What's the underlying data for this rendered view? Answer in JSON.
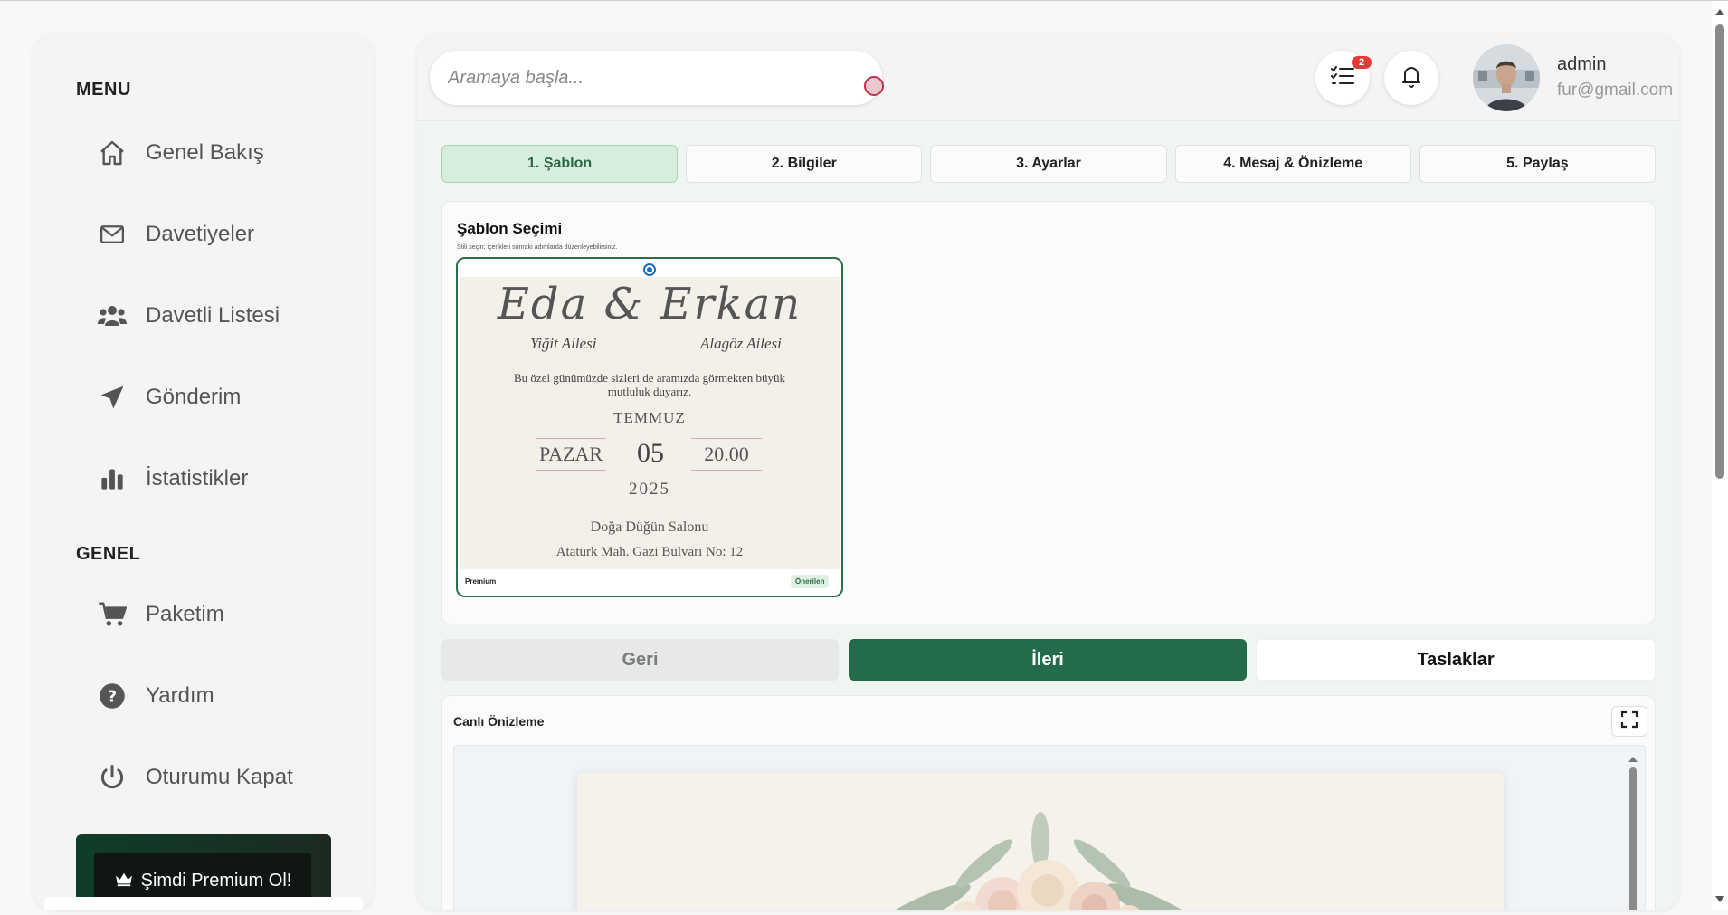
{
  "sidebar": {
    "menu_title": "MENU",
    "general_title": "GENEL",
    "items": [
      {
        "label": "Genel Bakış",
        "icon": "home-icon"
      },
      {
        "label": "Davetiyeler",
        "icon": "mail-icon"
      },
      {
        "label": "Davetli Listesi",
        "icon": "users-icon"
      },
      {
        "label": "Gönderim",
        "icon": "send-icon"
      },
      {
        "label": "İstatistikler",
        "icon": "bar-chart-icon"
      }
    ],
    "general_items": [
      {
        "label": "Paketim",
        "icon": "cart-icon"
      },
      {
        "label": "Yardım",
        "icon": "help-icon"
      },
      {
        "label": "Oturumu Kapat",
        "icon": "power-icon"
      }
    ],
    "premium_label": "Şimdi Premium Ol!"
  },
  "header": {
    "search_placeholder": "Aramaya başla...",
    "task_badge": "2",
    "user_name": "admin",
    "user_email": "fur@gmail.com"
  },
  "steps": [
    {
      "label": "1. Şablon",
      "active": true
    },
    {
      "label": "2. Bilgiler",
      "active": false
    },
    {
      "label": "3. Ayarlar",
      "active": false
    },
    {
      "label": "4. Mesaj & Önizleme",
      "active": false
    },
    {
      "label": "5. Paylaş",
      "active": false
    }
  ],
  "template_section": {
    "title": "Şablon Seçimi",
    "subtitle": "Stili seçin; içerikleri sonraki adımlarda düzenleyebilirsiniz.",
    "card": {
      "names": "Eda & Erkan",
      "family_left": "Yiğit Ailesi",
      "family_right": "Alagöz Ailesi",
      "message": "Bu özel günümüzde sizleri de aramızda görmekten büyük mutluluk duyarız.",
      "month": "TEMMUZ",
      "weekday": "PAZAR",
      "day": "05",
      "time": "20.00",
      "year": "2025",
      "venue": "Doğa Düğün Salonu",
      "address": "Atatürk Mah. Gazi Bulvarı No: 12",
      "tier": "Premium",
      "tag": "Önerilen"
    }
  },
  "actions": {
    "back": "Geri",
    "next": "İleri",
    "drafts": "Taslaklar"
  },
  "preview": {
    "title": "Canlı Önizleme"
  },
  "colors": {
    "accent": "#236b4a",
    "active_tab_bg": "#d7eedc",
    "badge": "#e53935"
  }
}
